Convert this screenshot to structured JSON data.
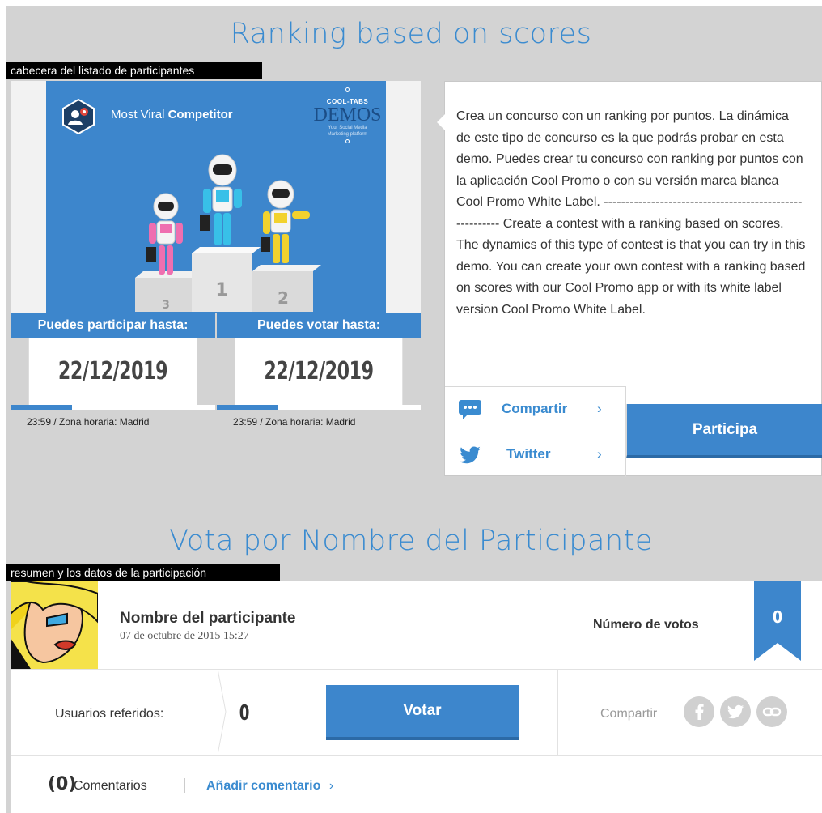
{
  "section1": {
    "title": "Ranking based on scores",
    "tag": "cabecera del listado de participantes"
  },
  "hero": {
    "brand_regular": "Most Viral ",
    "brand_bold": "Competitor",
    "demos_small": "COOL-TABS",
    "demos_big": "DEMOS",
    "demos_tiny_1": "Your Social Media",
    "demos_tiny_2": "Marketing platform",
    "podium": {
      "first": "1",
      "second": "2",
      "third": "3"
    }
  },
  "dates": [
    {
      "head": "Puedes participar hasta:",
      "value": "22/12/2019",
      "note": "23:59 / Zona horaria: Madrid",
      "progress_percent": 30
    },
    {
      "head": "Puedes votar hasta:",
      "value": "22/12/2019",
      "note": "23:59 / Zona horaria: Madrid",
      "progress_percent": 30
    }
  ],
  "description": {
    "text": "Crea un concurso con un ranking por puntos. La dinámica de este tipo de concurso es la que podrás probar en esta demo. Puedes crear tu concurso con ranking por puntos con la aplicación Cool Promo o con su versión marca blanca Cool Promo White Label. -------------------------------------------------------- Create a contest with a ranking based on scores. The dynamics of this type of contest is that you can try in this demo. You can create your own contest with a ranking based on scores with our Cool Promo app or with its white label version Cool Promo White Label.",
    "share_label": "Compartir",
    "twitter_label": "Twitter",
    "chevron": "›",
    "participa_label": "Participa"
  },
  "section2": {
    "title": "Vota por Nombre del Participante",
    "tag": "resumen y los datos de la participación"
  },
  "participant": {
    "name": "Nombre del participante",
    "date": "07 de octubre de 2015 15:27",
    "votes_label": "Número de votos",
    "votes_count": "0",
    "referred_label": "Usuarios referidos:",
    "referred_count": "0",
    "vote_button": "Votar",
    "share_label": "Compartir",
    "comments_count": "(0)",
    "comments_label": "Comentarios",
    "add_comment": "Añadir comentario",
    "add_chevron": "›"
  },
  "colors": {
    "accent": "#3d86cc",
    "accent_dark": "#2c6aa6",
    "frame_bg": "#d3d3d3",
    "title_blue": "#3a8bd0"
  }
}
